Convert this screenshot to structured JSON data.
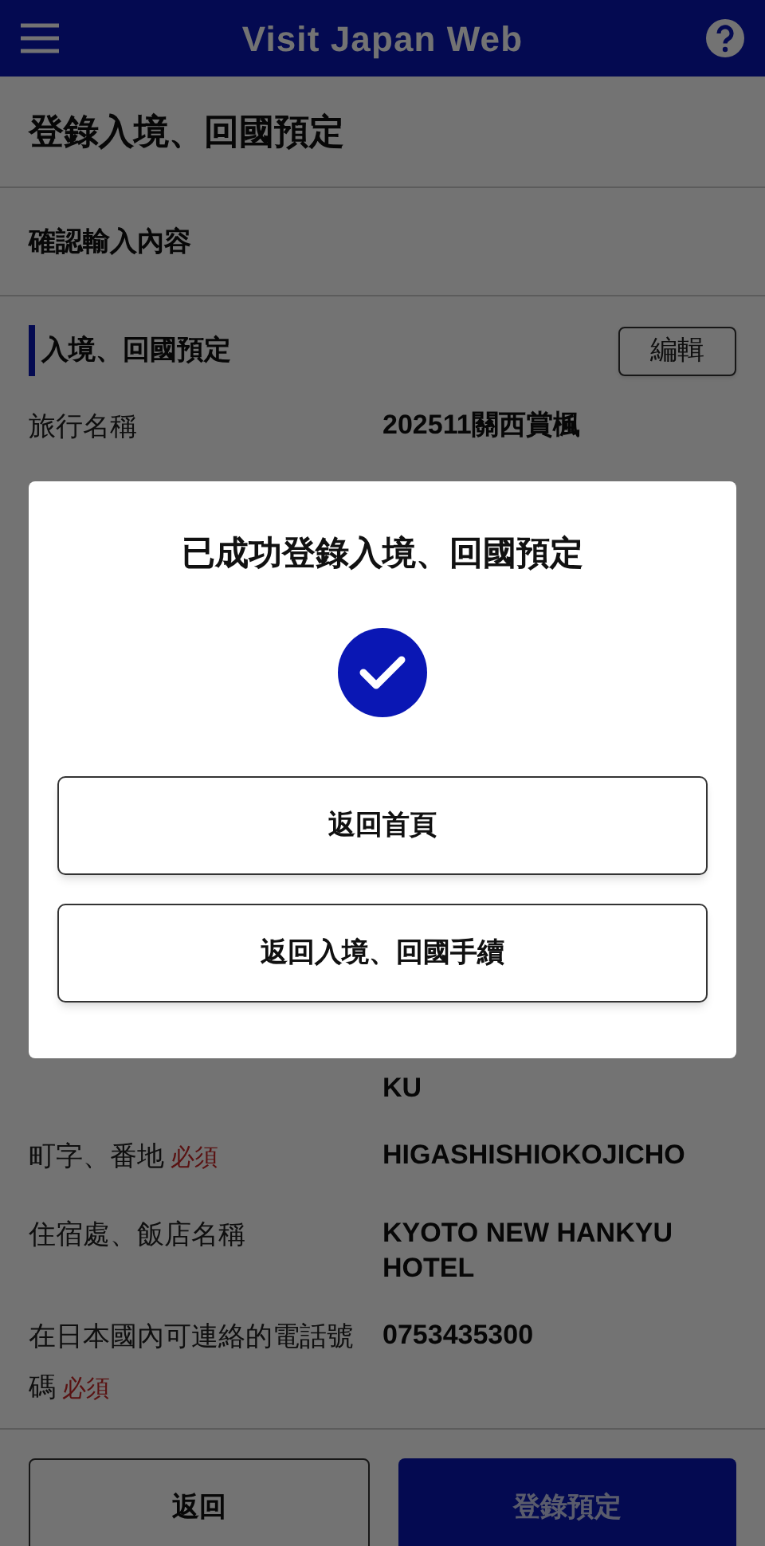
{
  "header": {
    "title": "Visit Japan Web"
  },
  "page_title": "登錄入境、回國預定",
  "subtitle": "確認輸入內容",
  "section": {
    "title": "入境、回國預定",
    "edit_button": "編輯"
  },
  "rows_top": [
    {
      "kind": "field",
      "label": "旅行名稱",
      "value": "202511關西賞楓"
    }
  ],
  "rows_bottom": [
    {
      "kind": "value_only",
      "value": "KU"
    },
    {
      "kind": "field",
      "label": "町字、番地",
      "tag": "必須",
      "value": "HIGASHISHIOKOJICHO"
    },
    {
      "kind": "field",
      "label": "住宿處、飯店名稱",
      "value": "KYOTO NEW HANKYU HOTEL"
    },
    {
      "kind": "field",
      "label": "在日本國內可連絡的電話號碼",
      "tag": "必須",
      "value": "0753435300"
    }
  ],
  "footer": {
    "back": "返回",
    "submit": "登錄預定"
  },
  "dialog": {
    "title": "已成功登錄入境、回國預定",
    "buttons": [
      "返回首頁",
      "返回入境、回國手續"
    ]
  }
}
